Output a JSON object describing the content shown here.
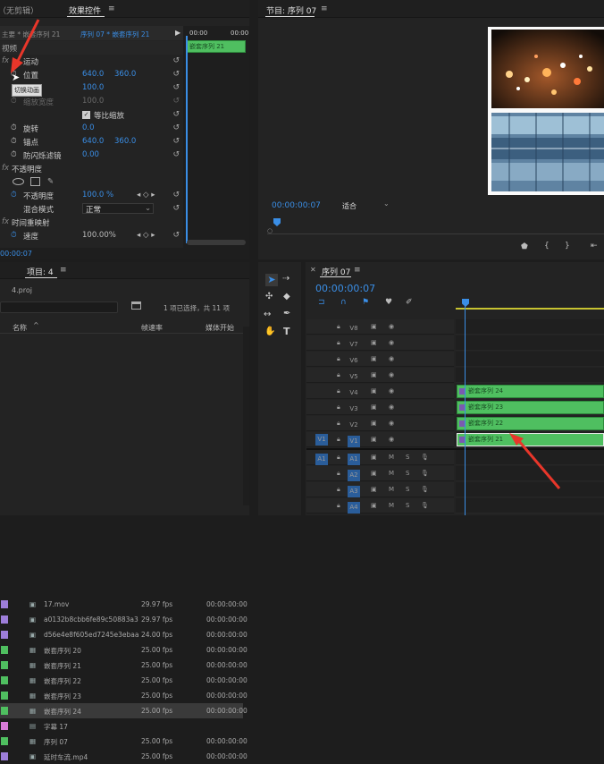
{
  "top_tabs": {
    "source": "（无剪辑）",
    "effect_controls": "效果控件",
    "program": "节目: 序列 07"
  },
  "effect_controls": {
    "breadcrumb": "主要 * 嵌套序列 21",
    "seq_link": "序列 07 * 嵌套序列 21",
    "tc_start": "00:00",
    "tc_end": "00:00",
    "mini_clip": "嵌套序列 21",
    "section_video": "视频",
    "motion": "运动",
    "position_label": "位置",
    "position_x": "640.0",
    "position_y": "360.0",
    "tooltip": "切换动画",
    "scale_value": "100.0",
    "scale_width_label": "缩放宽度",
    "scale_width_value": "100.0",
    "uniform_scale": "等比缩放",
    "rotation_label": "旋转",
    "rotation_value": "0.0",
    "anchor_label": "锚点",
    "anchor_x": "640.0",
    "anchor_y": "360.0",
    "antiflicker_label": "防闪烁滤镜",
    "antiflicker_value": "0.00",
    "opacity_section": "不透明度",
    "opacity_label": "不透明度",
    "opacity_value": "100.0 %",
    "blend_label": "混合模式",
    "blend_value": "正常",
    "timeremap_label": "时间重映射",
    "speed_label": "速度",
    "speed_value": "100.00%",
    "current_time": "00:00:07"
  },
  "program": {
    "timecode": "00:00:00:07",
    "fit": "适合"
  },
  "project": {
    "title": "项目: 4",
    "file": "4.proj",
    "selection_info": "1 项已选择，共 11 项",
    "columns": {
      "name": "名称",
      "fps": "帧速率",
      "start": "媒体开始"
    },
    "rows": [
      {
        "name": "17.mov",
        "fps": "29.97 fps",
        "start": "00:00:00:00",
        "color": "#9d7ed9",
        "type": "clip"
      },
      {
        "name": "a0132b8cbb6fe89c50883a3",
        "fps": "29.97 fps",
        "start": "00:00:00:00",
        "color": "#9d7ed9",
        "type": "clip"
      },
      {
        "name": "d56e4e8f605ed7245e3ebaa",
        "fps": "24.00 fps",
        "start": "00:00:00:00",
        "color": "#9d7ed9",
        "type": "clip"
      },
      {
        "name": "嵌套序列 20",
        "fps": "25.00 fps",
        "start": "00:00:00:00",
        "color": "#4fbf60",
        "type": "seq"
      },
      {
        "name": "嵌套序列 21",
        "fps": "25.00 fps",
        "start": "00:00:00:00",
        "color": "#4fbf60",
        "type": "seq"
      },
      {
        "name": "嵌套序列 22",
        "fps": "25.00 fps",
        "start": "00:00:00:00",
        "color": "#4fbf60",
        "type": "seq"
      },
      {
        "name": "嵌套序列 23",
        "fps": "25.00 fps",
        "start": "00:00:00:00",
        "color": "#4fbf60",
        "type": "seq"
      },
      {
        "name": "嵌套序列 24",
        "fps": "25.00 fps",
        "start": "00:00:00:00",
        "color": "#4fbf60",
        "type": "seq"
      },
      {
        "name": "字幕 17",
        "fps": "",
        "start": "",
        "color": "#d67bd6",
        "type": "title"
      },
      {
        "name": "序列 07",
        "fps": "25.00 fps",
        "start": "00:00:00:00",
        "color": "#4fbf60",
        "type": "seq"
      },
      {
        "name": "延时车流.mp4",
        "fps": "25.00 fps",
        "start": "00:00:00:00",
        "color": "#9d7ed9",
        "type": "clip"
      }
    ]
  },
  "timeline": {
    "title": "序列 07",
    "timecode": "00:00:00:07",
    "video_tracks": [
      "V8",
      "V7",
      "V6",
      "V5",
      "V4",
      "V3",
      "V2",
      "V1"
    ],
    "audio_tracks": [
      "A1",
      "A2",
      "A3",
      "A4"
    ],
    "src_v": "V1",
    "src_a": "A1",
    "clips": [
      "嵌套序列 24",
      "嵌套序列 23",
      "嵌套序列 22",
      "嵌套序列 21"
    ]
  }
}
